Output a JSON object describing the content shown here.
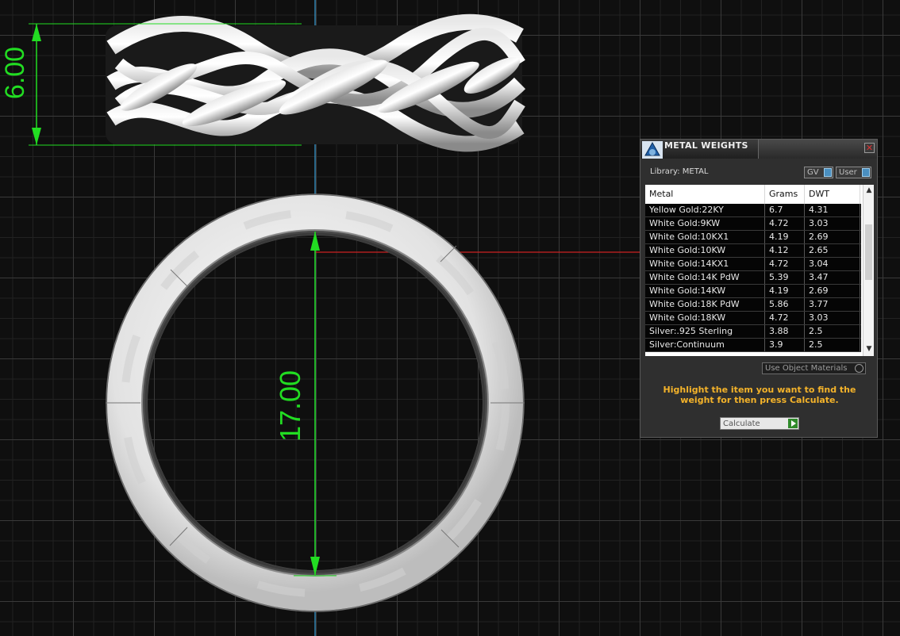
{
  "viewport": {
    "dimension_height": "6.00",
    "dimension_diameter": "17.00"
  },
  "panel": {
    "title": "METAL WEIGHTS",
    "library_label": "Library: METAL",
    "gv_chip": "GV",
    "user_chip": "User",
    "columns": [
      "Metal",
      "Grams",
      "DWT"
    ],
    "rows": [
      {
        "metal": "Yellow Gold:22KY",
        "grams": "6.7",
        "dwt": "4.31"
      },
      {
        "metal": "White Gold:9KW",
        "grams": "4.72",
        "dwt": "3.03"
      },
      {
        "metal": "White Gold:10KX1",
        "grams": "4.19",
        "dwt": "2.69"
      },
      {
        "metal": "White Gold:10KW",
        "grams": "4.12",
        "dwt": "2.65"
      },
      {
        "metal": "White Gold:14KX1",
        "grams": "4.72",
        "dwt": "3.04"
      },
      {
        "metal": "White Gold:14K PdW",
        "grams": "5.39",
        "dwt": "3.47"
      },
      {
        "metal": "White Gold:14KW",
        "grams": "4.19",
        "dwt": "2.69"
      },
      {
        "metal": "White Gold:18K PdW",
        "grams": "5.86",
        "dwt": "3.77"
      },
      {
        "metal": "White Gold:18KW",
        "grams": "4.72",
        "dwt": "3.03"
      },
      {
        "metal": "Silver:.925 Sterling",
        "grams": "3.88",
        "dwt": "2.5"
      },
      {
        "metal": "Silver:Continuum",
        "grams": "3.9",
        "dwt": "2.5"
      }
    ],
    "use_object_materials": "Use Object Materials",
    "instructions": "Highlight the item you want to find the weight for then press Calculate.",
    "calculate_label": "Calculate"
  },
  "colors": {
    "dimension": "#22dd22",
    "axis_blue": "#3aa0d8",
    "axis_red": "#cc2222",
    "panel_highlight_text": "#f4b32a"
  }
}
